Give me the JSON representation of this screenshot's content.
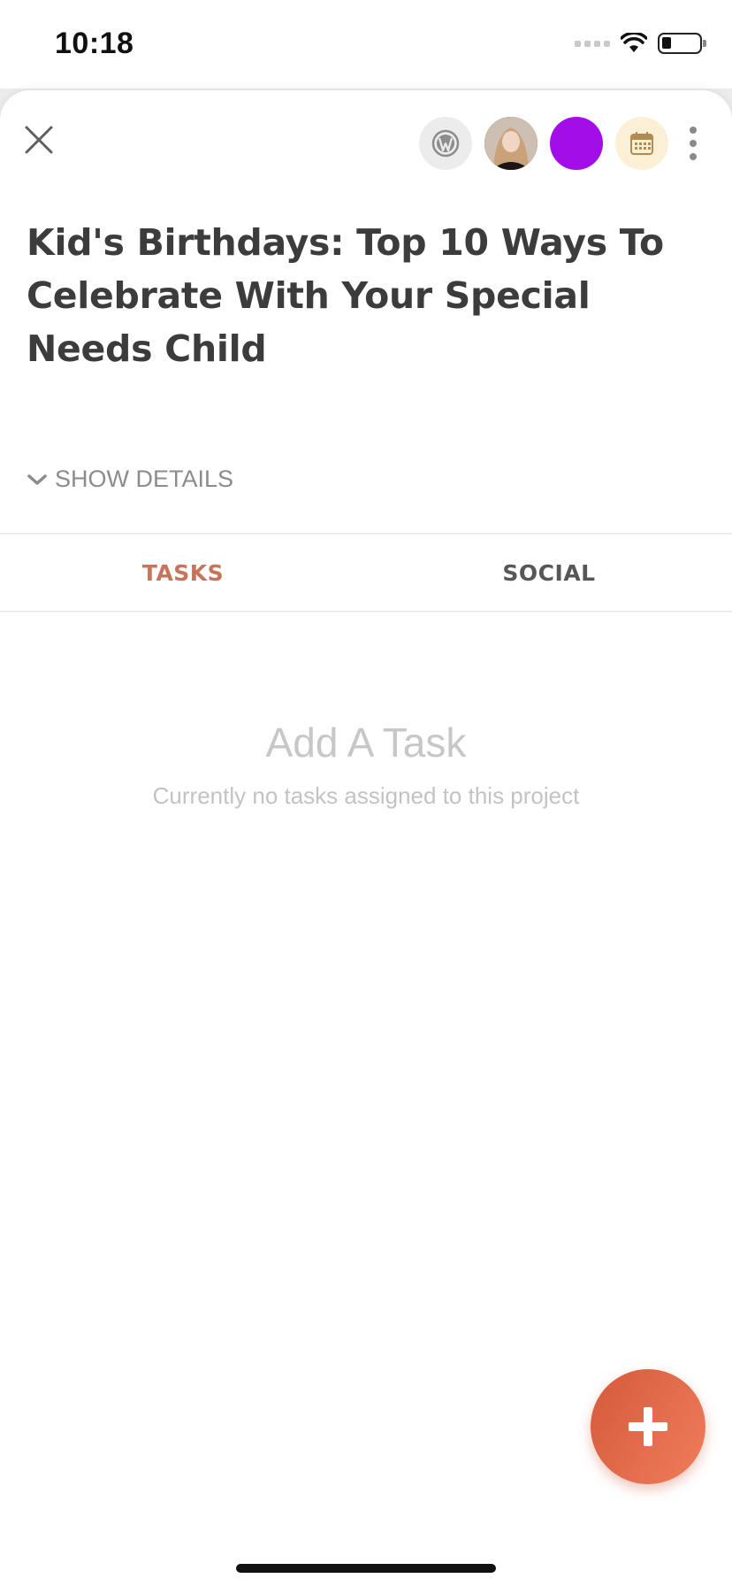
{
  "status_bar": {
    "time": "10:18",
    "icons": [
      "cellular-signal-icon",
      "wifi-icon",
      "battery-icon"
    ]
  },
  "header": {
    "close_icon": "close-icon",
    "actions": [
      {
        "name": "wordpress-icon"
      },
      {
        "name": "user-avatar"
      },
      {
        "name": "purple-color-swatch",
        "color": "#a30de8"
      },
      {
        "name": "calendar-icon"
      },
      {
        "name": "more-options-icon"
      }
    ]
  },
  "project": {
    "title": "Kid's Birthdays: Top 10 Ways To Celebrate With Your Special Needs Child",
    "show_details_label": "SHOW DETAILS"
  },
  "tabs": [
    {
      "label": "TASKS",
      "active": true
    },
    {
      "label": "SOCIAL",
      "active": false
    }
  ],
  "empty_state": {
    "title": "Add A Task",
    "subtitle": "Currently no tasks assigned to this project"
  },
  "fab": {
    "icon": "plus-icon"
  },
  "colors": {
    "accent": "#c87458",
    "fab_gradient_start": "#d45a3c",
    "fab_gradient_end": "#f07d5c",
    "swatch": "#a30de8"
  }
}
